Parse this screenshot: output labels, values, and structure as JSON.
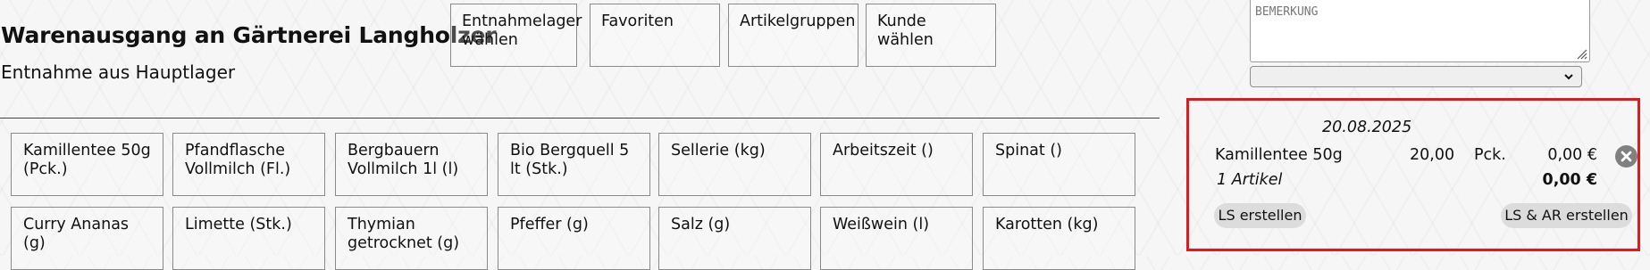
{
  "header": {
    "title": "Warenausgang an Gärtnerei Langholzer",
    "subtitle": "Entnahme aus Hauptlager"
  },
  "top_buttons": [
    {
      "label": "Entnahmelager wählen"
    },
    {
      "label": "Favoriten"
    },
    {
      "label": "Artikelgruppen"
    },
    {
      "label": "Kunde wählen"
    }
  ],
  "remark": {
    "placeholder": "BEMERKUNG"
  },
  "select": {
    "value": ""
  },
  "articles": [
    {
      "label": "Kamillentee 50g (Pck.)"
    },
    {
      "label": "Pfandflasche Vollmilch (Fl.)"
    },
    {
      "label": "Bergbauern Vollmilch 1l (l)"
    },
    {
      "label": "Bio Bergquell 5 lt (Stk.)"
    },
    {
      "label": "Sellerie (kg)"
    },
    {
      "label": "Arbeitszeit ()"
    },
    {
      "label": "Spinat ()"
    },
    {
      "label": "Curry Ananas (g)"
    },
    {
      "label": "Limette (Stk.)"
    },
    {
      "label": "Thymian getrocknet (g)"
    },
    {
      "label": "Pfeffer (g)"
    },
    {
      "label": "Salz (g)"
    },
    {
      "label": "Weißwein (l)"
    },
    {
      "label": "Karotten (kg)"
    }
  ],
  "cart": {
    "date": "20.08.2025",
    "items": [
      {
        "name": "Kamillentee 50g",
        "qty": "20,00",
        "unit": "Pck.",
        "price": "0,00 €"
      }
    ],
    "count_label": "1 Artikel",
    "total": "0,00 €",
    "btn_ls": "LS erstellen",
    "btn_ls_ar": "LS & AR erstellen"
  },
  "colors": {
    "highlight_border": "#e01a1a",
    "remove_button": "#808080",
    "pill_bg": "#dcdcdc"
  },
  "icons": {
    "remove": "x-circle-icon",
    "dropdown": "chevron-down-icon",
    "resize": "resize-grip-icon"
  }
}
